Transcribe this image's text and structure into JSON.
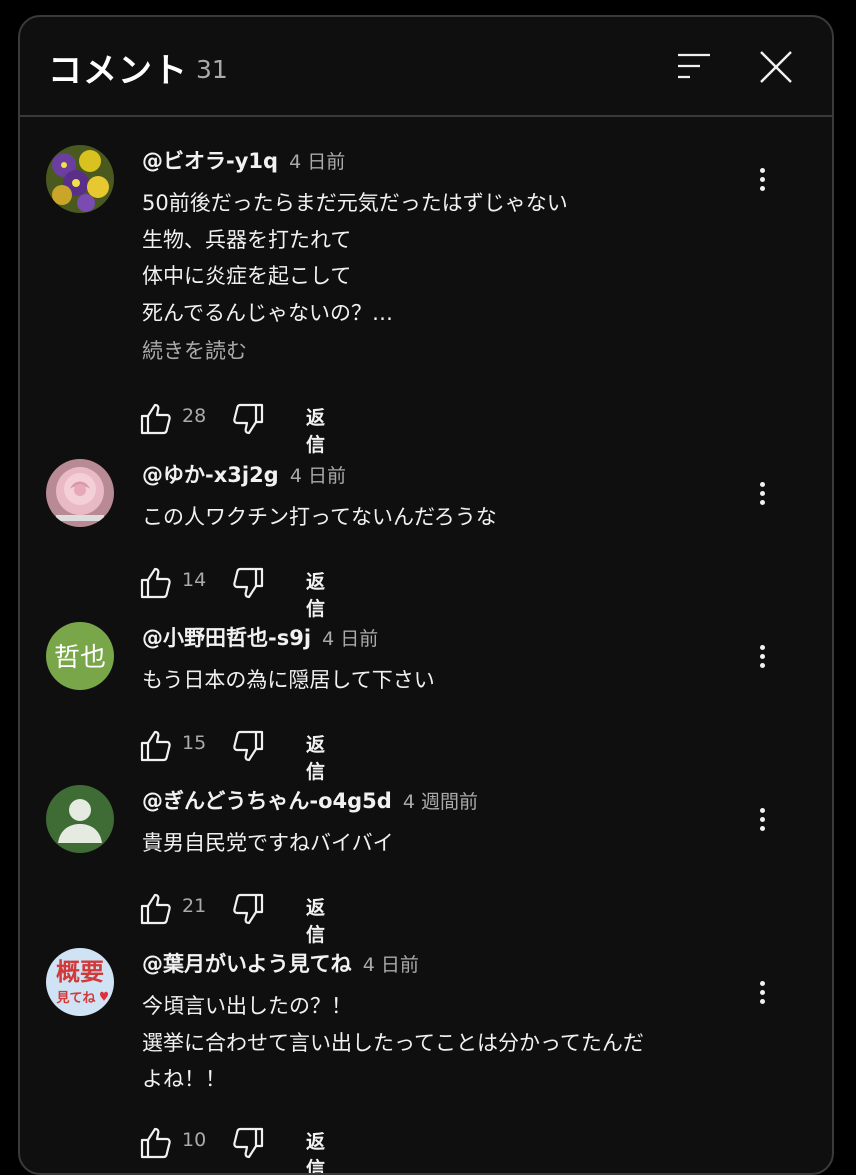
{
  "header": {
    "title": "コメント",
    "count": "31",
    "sort_icon": "sort-icon",
    "close_icon": "close-icon"
  },
  "comments": [
    {
      "author": "@ビオラ-y1q",
      "time": "4 日前",
      "text": "50前後だったらまだ元気だったはずじゃない\n生物、兵器を打たれて\n体中に炎症を起こして\n死んでるんじゃないの？…",
      "more": "続きを読む",
      "likes": "28",
      "reply": "返信",
      "avatar": "pansy-flowers-photo"
    },
    {
      "author": "@ゆか-x3j2g",
      "time": "4 日前",
      "text": "この人ワクチン打ってないんだろうな",
      "likes": "14",
      "reply": "返信",
      "avatar": "pink-rose-photo"
    },
    {
      "author": "@小野田哲也-s9j",
      "time": "4 日前",
      "text": "もう日本の為に隠居して下さい",
      "likes": "15",
      "reply": "返信",
      "avatar_text": "哲也",
      "avatar_color": "#7aa64a"
    },
    {
      "author": "@ぎんどうちゃん-o4g5d",
      "time": "4 週間前",
      "text": "貴男自民党ですねバイバイ",
      "likes": "21",
      "reply": "返信",
      "avatar": "default-user-icon",
      "avatar_color": "#3f6b35"
    },
    {
      "author": "@葉月がいよう見てね",
      "time": "4 日前",
      "text": "今頃言い出したの？！\n選挙に合わせて言い出したってことは分かってたんだ\nよね！！",
      "likes": "10",
      "reply": "返信",
      "avatar_text_top": "概要",
      "avatar_text_bottom": "見てね",
      "avatar_color": "#cfe3f5"
    }
  ]
}
